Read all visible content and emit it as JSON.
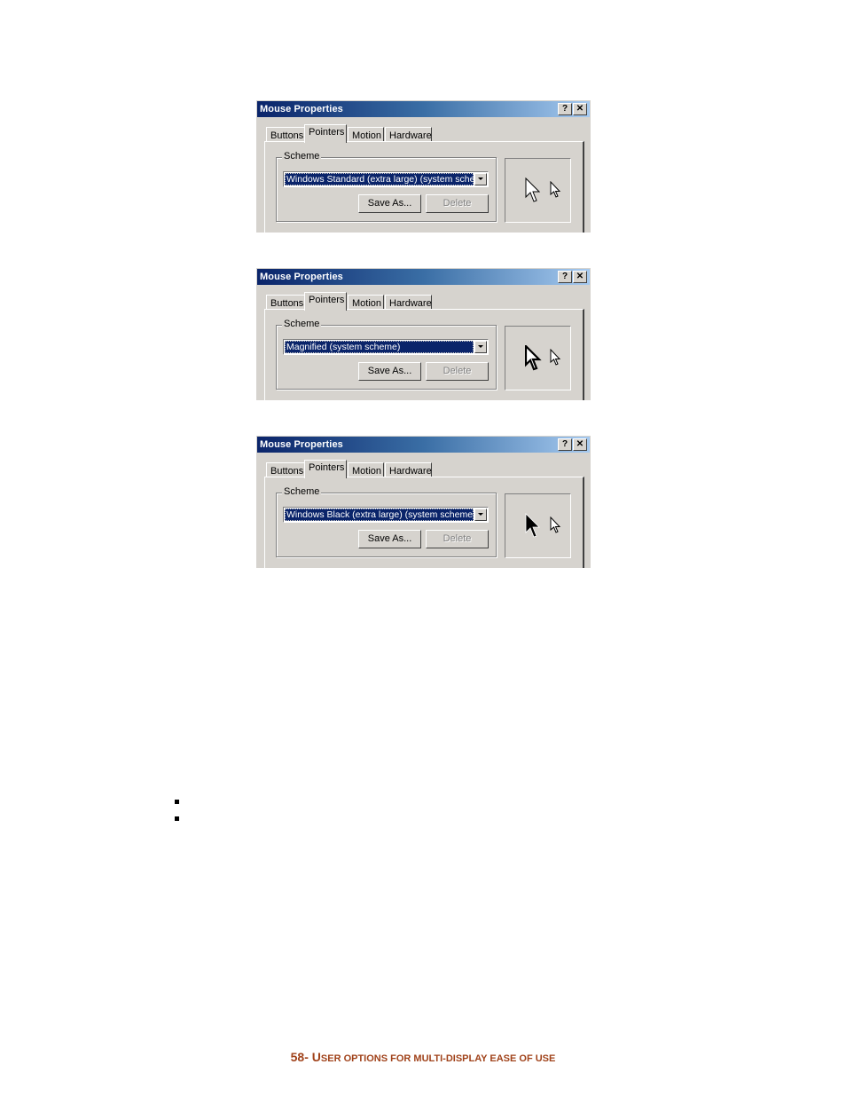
{
  "dialogs": [
    {
      "title": "Mouse Properties",
      "help_button": "?",
      "close_button": "✕",
      "tabs": [
        "Buttons",
        "Pointers",
        "Motion",
        "Hardware"
      ],
      "active_tab": "Pointers",
      "group_label": "Scheme",
      "scheme_value": "Windows Standard (extra large) (system scheme)",
      "save_as_label": "Save As...",
      "delete_label": "Delete",
      "preview_cursor_style": "white"
    },
    {
      "title": "Mouse Properties",
      "help_button": "?",
      "close_button": "✕",
      "tabs": [
        "Buttons",
        "Pointers",
        "Motion",
        "Hardware"
      ],
      "active_tab": "Pointers",
      "group_label": "Scheme",
      "scheme_value": "Magnified (system scheme)",
      "save_as_label": "Save As...",
      "delete_label": "Delete",
      "preview_cursor_style": "white-bold"
    },
    {
      "title": "Mouse Properties",
      "help_button": "?",
      "close_button": "✕",
      "tabs": [
        "Buttons",
        "Pointers",
        "Motion",
        "Hardware"
      ],
      "active_tab": "Pointers",
      "group_label": "Scheme",
      "scheme_value": "Windows Black (extra large) (system scheme)",
      "save_as_label": "Save As...",
      "delete_label": "Delete",
      "preview_cursor_style": "black"
    }
  ],
  "bullets_count": 2,
  "footer": {
    "page_number": "58-",
    "title_initial": "U",
    "title_rest": "SER OPTIONS FOR MULTI-DISPLAY EASE OF USE"
  },
  "colors": {
    "footer_text": "#a0421a",
    "title_bar_start": "#0a246a",
    "title_bar_end": "#a6caf0",
    "selection": "#0a246a",
    "dialog_face": "#d6d3ce"
  }
}
